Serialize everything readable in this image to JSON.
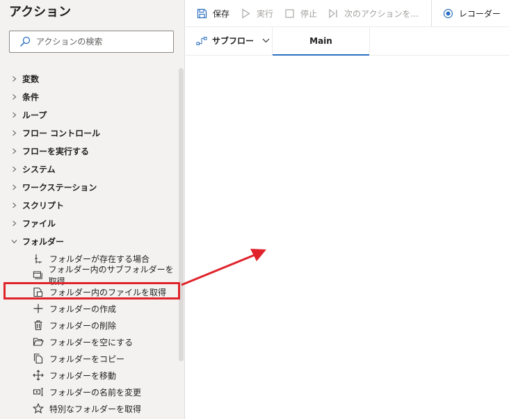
{
  "actions_pane": {
    "title": "アクション",
    "search": {
      "placeholder": "アクションの検索",
      "value": ""
    },
    "categories": [
      {
        "label": "変数",
        "expanded": false
      },
      {
        "label": "条件",
        "expanded": false
      },
      {
        "label": "ループ",
        "expanded": false
      },
      {
        "label": "フロー コントロール",
        "expanded": false
      },
      {
        "label": "フローを実行する",
        "expanded": false
      },
      {
        "label": "システム",
        "expanded": false
      },
      {
        "label": "ワークステーション",
        "expanded": false
      },
      {
        "label": "スクリプト",
        "expanded": false
      },
      {
        "label": "ファイル",
        "expanded": false
      },
      {
        "label": "フォルダー",
        "expanded": true
      }
    ],
    "folder_actions": [
      {
        "label": "フォルダーが存在する場合",
        "icon": "branch-icon"
      },
      {
        "label": "フォルダー内のサブフォルダーを取得",
        "icon": "folders-icon"
      },
      {
        "label": "フォルダー内のファイルを取得",
        "icon": "folder-files-icon",
        "highlighted": true
      },
      {
        "label": "フォルダーの作成",
        "icon": "plus-icon"
      },
      {
        "label": "フォルダーの削除",
        "icon": "trash-icon"
      },
      {
        "label": "フォルダーを空にする",
        "icon": "open-folder-icon"
      },
      {
        "label": "フォルダーをコピー",
        "icon": "copy-icon"
      },
      {
        "label": "フォルダーを移動",
        "icon": "move-icon"
      },
      {
        "label": "フォルダーの名前を変更",
        "icon": "rename-icon"
      },
      {
        "label": "特別なフォルダーを取得",
        "icon": "star-icon"
      }
    ]
  },
  "toolbar": {
    "save_label": "保存",
    "run_label": "実行",
    "stop_label": "停止",
    "next_action_label": "次のアクションを...",
    "recorder_label": "レコーダー"
  },
  "tabs": {
    "subflow_label": "サブフロー",
    "main_label": "Main"
  },
  "colors": {
    "accent": "#2b6fc0",
    "highlight": "#e0232b",
    "pane_bg": "#f3f2f1"
  }
}
